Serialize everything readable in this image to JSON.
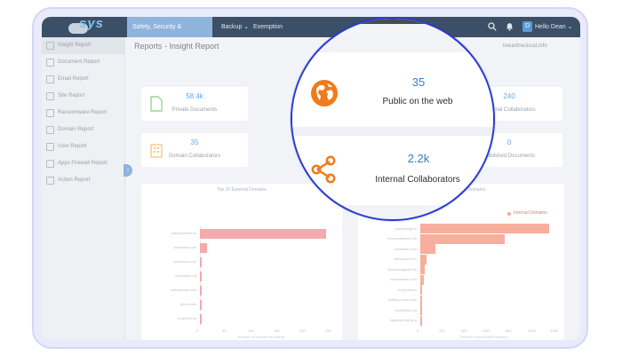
{
  "app": {
    "logo_text": "sys"
  },
  "topbar": {
    "nav": [
      {
        "label": "Safety, Security & Compliance ⌄"
      },
      {
        "label": "Backup ⌄"
      },
      {
        "label": "Exemption"
      }
    ],
    "avatar_letter": "D",
    "user_label": "Hello Dean ⌄"
  },
  "sidebar": {
    "items": [
      {
        "label": "Insight Report"
      },
      {
        "label": "Document Report"
      },
      {
        "label": "Email Report"
      },
      {
        "label": "Site Report"
      },
      {
        "label": "Ransomware Report"
      },
      {
        "label": "Domain Report"
      },
      {
        "label": "User Report"
      },
      {
        "label": "Apps Firewall Report"
      },
      {
        "label": "Action Report"
      }
    ],
    "collapse_glyph": "‹"
  },
  "main": {
    "title": "Reports - Insight Report",
    "tenant": "linearlinecloud.info",
    "cards": [
      {
        "value": "58.4k",
        "caption": "Private Documents"
      },
      {
        "value": "240",
        "caption": "External Collaborators"
      },
      {
        "value": "35",
        "caption": "Domain Collaborators"
      },
      {
        "value": "0",
        "caption": "Published Documents"
      }
    ]
  },
  "lens": {
    "card1": {
      "value": "35",
      "caption": "Public on the web"
    },
    "card2": {
      "value": "2.2k",
      "caption": "Internal Collaborators"
    }
  },
  "colors": {
    "accent": "#2f80c8",
    "lens_border": "#2a3bd1",
    "icon_orange": "#f07a1c",
    "bar_left": "#f4a9ad",
    "bar_right": "#f8ae9c"
  },
  "chart_data": [
    {
      "type": "bar",
      "orientation": "horizontal",
      "title": "Top 10 External Domains",
      "categories": [
        "yahoodomain.io",
        "zoochash.com",
        "webcloud.com",
        "zoochash.org",
        "outlooknote.com",
        "gmax.com",
        "coopr.test.io"
      ],
      "values": [
        245,
        14,
        2,
        1,
        1,
        1,
        1
      ],
      "x_ticks": [
        "0",
        "50",
        "100",
        "150",
        "200",
        "250"
      ],
      "xlim": [
        0,
        250
      ],
      "xlabel": "Number of documents shared"
    },
    {
      "type": "bar",
      "orientation": "horizontal",
      "title": "Top 10 Internal Domains",
      "legend": "Internal Domains",
      "categories": [
        "publiclodge.io",
        "linearsoftware.info",
        "zoochash.com",
        "webcloud.com",
        "linearmarginal.info",
        "zoochashee.com",
        "coopr.test.io",
        "liveboy.moon.com",
        "zoochash.org",
        "typelog.testing.io"
      ],
      "values": [
        1210,
        790,
        140,
        60,
        40,
        30,
        20,
        15,
        10,
        8
      ],
      "x_ticks": [
        "0",
        "200",
        "400",
        "600",
        "800",
        "1000",
        "1200"
      ],
      "xlim": [
        0,
        1250
      ],
      "xlabel": "Number of documents shared"
    }
  ]
}
